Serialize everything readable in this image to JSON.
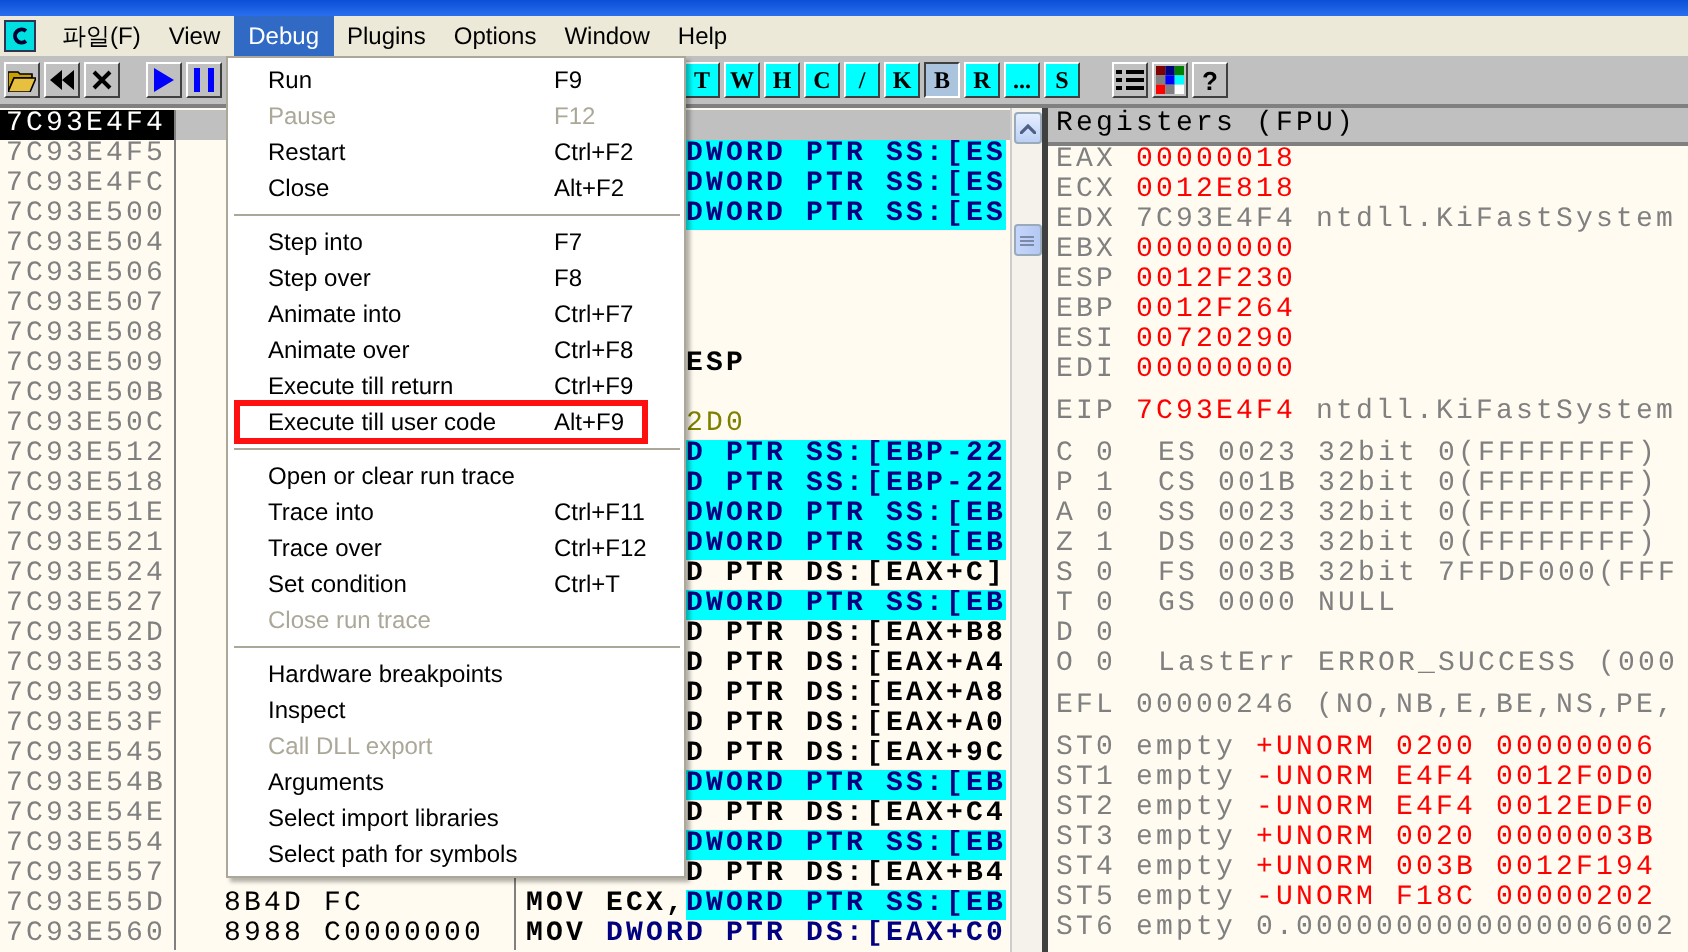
{
  "menubar": {
    "items": [
      {
        "label": "파일(F)",
        "selected": false
      },
      {
        "label": "View",
        "selected": false
      },
      {
        "label": "Debug",
        "selected": true
      },
      {
        "label": "Plugins",
        "selected": false
      },
      {
        "label": "Options",
        "selected": false
      },
      {
        "label": "Window",
        "selected": false
      },
      {
        "label": "Help",
        "selected": false
      }
    ]
  },
  "toolbar": {
    "letter_buttons": [
      {
        "label": "T",
        "selected": false
      },
      {
        "label": "W",
        "selected": false
      },
      {
        "label": "H",
        "selected": false
      },
      {
        "label": "C",
        "selected": false
      },
      {
        "label": "/",
        "selected": false
      },
      {
        "label": "K",
        "selected": false
      },
      {
        "label": "B",
        "selected": true
      },
      {
        "label": "R",
        "selected": false
      },
      {
        "label": "...",
        "selected": false
      },
      {
        "label": "S",
        "selected": false
      }
    ],
    "help_button": "?"
  },
  "menu": {
    "items": [
      {
        "kind": "item",
        "label": "Run",
        "shortcut": "F9",
        "disabled": false,
        "marked": false
      },
      {
        "kind": "item",
        "label": "Pause",
        "shortcut": "F12",
        "disabled": true,
        "marked": false
      },
      {
        "kind": "item",
        "label": "Restart",
        "shortcut": "Ctrl+F2",
        "disabled": false,
        "marked": false
      },
      {
        "kind": "item",
        "label": "Close",
        "shortcut": "Alt+F2",
        "disabled": false,
        "marked": false
      },
      {
        "kind": "separator"
      },
      {
        "kind": "item",
        "label": "Step into",
        "shortcut": "F7",
        "disabled": false,
        "marked": false
      },
      {
        "kind": "item",
        "label": "Step over",
        "shortcut": "F8",
        "disabled": false,
        "marked": false
      },
      {
        "kind": "item",
        "label": "Animate into",
        "shortcut": "Ctrl+F7",
        "disabled": false,
        "marked": false
      },
      {
        "kind": "item",
        "label": "Animate over",
        "shortcut": "Ctrl+F8",
        "disabled": false,
        "marked": false
      },
      {
        "kind": "item",
        "label": "Execute till return",
        "shortcut": "Ctrl+F9",
        "disabled": false,
        "marked": false
      },
      {
        "kind": "item",
        "label": "Execute till user code",
        "shortcut": "Alt+F9",
        "disabled": false,
        "marked": true
      },
      {
        "kind": "separator"
      },
      {
        "kind": "item",
        "label": "Open or clear run trace",
        "disabled": false,
        "marked": false
      },
      {
        "kind": "item",
        "label": "Trace into",
        "shortcut": "Ctrl+F11",
        "disabled": false,
        "marked": false
      },
      {
        "kind": "item",
        "label": "Trace over",
        "shortcut": "Ctrl+F12",
        "disabled": false,
        "marked": false
      },
      {
        "kind": "item",
        "label": "Set condition",
        "shortcut": "Ctrl+T",
        "disabled": false,
        "marked": false
      },
      {
        "kind": "item",
        "label": "Close run trace",
        "disabled": true,
        "marked": false
      },
      {
        "kind": "separator"
      },
      {
        "kind": "item",
        "label": "Hardware breakpoints",
        "disabled": false,
        "marked": false
      },
      {
        "kind": "item",
        "label": "Inspect",
        "disabled": false,
        "marked": false
      },
      {
        "kind": "item",
        "label": "Call DLL export",
        "disabled": true,
        "marked": false
      },
      {
        "kind": "item",
        "label": "Arguments",
        "disabled": false,
        "marked": false
      },
      {
        "kind": "item",
        "label": "Select import libraries",
        "disabled": false,
        "marked": false
      },
      {
        "kind": "item",
        "label": "Select path for symbols",
        "disabled": false,
        "marked": false
      }
    ]
  },
  "disassembly": {
    "rows": [
      {
        "address": "7C93E4F4",
        "selected": true
      },
      {
        "address": "7C93E4F5",
        "selected": false,
        "operand": "DWORD PTR SS:[ES",
        "highlighted": true
      },
      {
        "address": "7C93E4FC",
        "selected": false,
        "operand": "DWORD PTR SS:[ES",
        "highlighted": true
      },
      {
        "address": "7C93E500",
        "selected": false,
        "operand": "DWORD PTR SS:[ES",
        "highlighted": true
      },
      {
        "address": "7C93E504",
        "selected": false
      },
      {
        "address": "7C93E506",
        "selected": false
      },
      {
        "address": "7C93E507",
        "selected": false
      },
      {
        "address": "7C93E508",
        "selected": false
      },
      {
        "address": "7C93E509",
        "selected": false,
        "operand": "ESP",
        "highlighted": false
      },
      {
        "address": "7C93E50B",
        "selected": false
      },
      {
        "address": "7C93E50C",
        "selected": false,
        "constant": "2D0"
      },
      {
        "address": "7C93E512",
        "selected": false,
        "operand": "D PTR SS:[EBP-22",
        "highlighted": true
      },
      {
        "address": "7C93E518",
        "selected": false,
        "operand": "D PTR SS:[EBP-22",
        "highlighted": true
      },
      {
        "address": "7C93E51E",
        "selected": false,
        "operand": "DWORD PTR SS:[EB",
        "highlighted": true
      },
      {
        "address": "7C93E521",
        "selected": false,
        "operand": "DWORD PTR SS:[EB",
        "highlighted": true
      },
      {
        "address": "7C93E524",
        "selected": false,
        "operand": "D PTR DS:[EAX+C]",
        "highlighted": false
      },
      {
        "address": "7C93E527",
        "selected": false,
        "operand": "DWORD PTR SS:[EB",
        "highlighted": true
      },
      {
        "address": "7C93E52D",
        "selected": false,
        "operand": "D PTR DS:[EAX+B8",
        "highlighted": false
      },
      {
        "address": "7C93E533",
        "selected": false,
        "operand": "D PTR DS:[EAX+A4",
        "highlighted": false
      },
      {
        "address": "7C93E539",
        "selected": false,
        "operand": "D PTR DS:[EAX+A8",
        "highlighted": false
      },
      {
        "address": "7C93E53F",
        "selected": false,
        "operand": "D PTR DS:[EAX+A0",
        "highlighted": false
      },
      {
        "address": "7C93E545",
        "selected": false,
        "operand": "D PTR DS:[EAX+9C",
        "highlighted": false
      },
      {
        "address": "7C93E54B",
        "selected": false,
        "operand": "DWORD PTR SS:[EB",
        "highlighted": true
      },
      {
        "address": "7C93E54E",
        "selected": false,
        "operand": "D PTR DS:[EAX+C4",
        "highlighted": false
      },
      {
        "address": "7C93E554",
        "selected": false,
        "operand": "DWORD PTR SS:[EB",
        "highlighted": true
      },
      {
        "address": "7C93E557",
        "selected": false,
        "operand": "D PTR DS:[EAX+B4",
        "highlighted": false
      },
      {
        "address": "7C93E55D",
        "selected": false,
        "hex": "8B4D FC",
        "mnemonic": "MOV",
        "prefix": "ECX,",
        "operand": "DWORD PTR SS:[EB",
        "highlighted": true
      },
      {
        "address": "7C93E560",
        "selected": false,
        "hex": "8988 C0000000",
        "mnemonic": "MOV",
        "operand": "DWORD PTR DS:[EAX+C0",
        "highlighted": false
      }
    ]
  },
  "registers": {
    "title": "Registers (FPU)",
    "general": [
      {
        "name": "EAX",
        "value": "00000018",
        "changed": true
      },
      {
        "name": "ECX",
        "value": "0012E818",
        "changed": true
      },
      {
        "name": "EDX",
        "value": "7C93E4F4",
        "changed": false,
        "comment": "ntdll.KiFastSystem"
      },
      {
        "name": "EBX",
        "value": "00000000",
        "changed": true
      },
      {
        "name": "ESP",
        "value": "0012F230",
        "changed": true
      },
      {
        "name": "EBP",
        "value": "0012F264",
        "changed": true
      },
      {
        "name": "ESI",
        "value": "00720290",
        "changed": true
      },
      {
        "name": "EDI",
        "value": "00000000",
        "changed": true
      }
    ],
    "eip": {
      "name": "EIP",
      "value": "7C93E4F4",
      "changed": true,
      "comment": "ntdll.KiFastSystem"
    },
    "flags": [
      {
        "flag": "C 0",
        "detail": "ES 0023 32bit 0(FFFFFFFF)"
      },
      {
        "flag": "P 1",
        "detail": "CS 001B 32bit 0(FFFFFFFF)"
      },
      {
        "flag": "A 0",
        "detail": "SS 0023 32bit 0(FFFFFFFF)"
      },
      {
        "flag": "Z 1",
        "detail": "DS 0023 32bit 0(FFFFFFFF)"
      },
      {
        "flag": "S 0",
        "detail": "FS 003B 32bit 7FFDF000(FFF"
      },
      {
        "flag": "T 0",
        "detail": "GS 0000 NULL"
      },
      {
        "flag": "D 0"
      },
      {
        "flag": "O 0",
        "detail": "LastErr ERROR_SUCCESS (000"
      }
    ],
    "efl": {
      "name": "EFL",
      "value": "00000246",
      "comment": "(NO,NB,E,BE,NS,PE,"
    },
    "fpu": [
      {
        "name": "ST0",
        "tag": "empty",
        "value": "+UNORM 0200 00000006",
        "changed": true
      },
      {
        "name": "ST1",
        "tag": "empty",
        "value": "-UNORM E4F4 0012F0D0",
        "changed": true
      },
      {
        "name": "ST2",
        "tag": "empty",
        "value": "-UNORM E4F4 0012EDF0",
        "changed": true
      },
      {
        "name": "ST3",
        "tag": "empty",
        "value": "+UNORM 0020 0000003B",
        "changed": true
      },
      {
        "name": "ST4",
        "tag": "empty",
        "value": "+UNORM 003B 0012F194",
        "changed": true
      },
      {
        "name": "ST5",
        "tag": "empty",
        "value": "-UNORM F18C 00000202",
        "changed": true
      },
      {
        "name": "ST6",
        "tag": "empty",
        "value": "0.0000000000000006002",
        "changed": false
      }
    ]
  }
}
